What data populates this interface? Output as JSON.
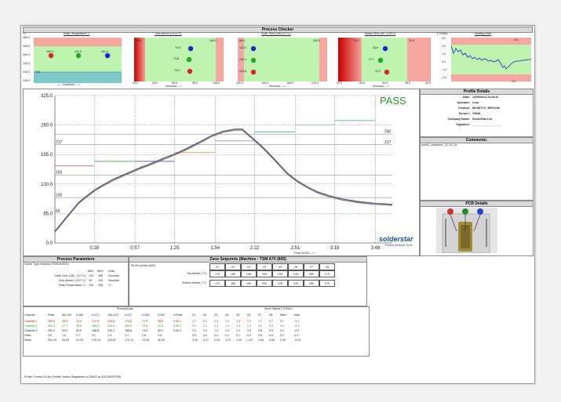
{
  "header": {
    "title": "Process Checker"
  },
  "mini_panels": [
    {
      "title": "Peak Temperature°C",
      "unit": "°C",
      "yticks": [
        "260.0",
        "255.0",
        "250.0",
        "245.0",
        "240.0",
        "235.0"
      ],
      "xlabel": "<--- Channels --->",
      "values": [
        "250.9",
        "251.3",
        "251.4"
      ],
      "marker": "240"
    },
    {
      "title": "Time Above (>217°C)",
      "left": "30.0",
      "right": "100.0",
      "xticks": [
        "25.0",
        "45.0",
        "65.0",
        "85.0",
        "105.0"
      ],
      "xlabel": "Seconds --->",
      "values": [
        "74.5",
        "73.8",
        "75.9"
      ]
    },
    {
      "title": "Soak Time (150-217°C)",
      "left": "60.0",
      "right": "240.0",
      "xticks": [
        "120.0",
        "150.0",
        "180.0",
        "210.0"
      ],
      "xlabel": "Seconds --->",
      "values": [
        "130.0",
        "130.4",
        "129.8"
      ],
      "left_labels": [
        "120.0",
        "130.4",
        "125.8"
      ]
    },
    {
      "title": "Ramp Time (65 - 125°C)",
      "left": "25.0",
      "right": "35.0",
      "xticks": [
        "20.0",
        "25.0",
        "30.0",
        "35.0",
        "40.0"
      ],
      "xlabel": "Seconds --->",
      "values": [
        "28.6",
        "27.7",
        "29.3"
      ],
      "left_labels": [
        "25.0",
        "27.7",
        "23.3"
      ]
    },
    {
      "title": "Heating Rate",
      "unit": "(°C/Sec)",
      "yticks": [
        "3.0",
        "2.0",
        "1.0",
        "0.0",
        "-1.0",
        "-2.0"
      ],
      "upper": "4.5",
      "lower": "-4.5"
    }
  ],
  "main_chart": {
    "status": "PASS",
    "yticks": [
      "325.0",
      "260.0",
      "195.0",
      "130.0",
      "65.0",
      "0.0"
    ],
    "xticks": [
      "0:28",
      "0:57",
      "1:25",
      "1:54",
      "2:22",
      "2:51",
      "3:19",
      "3:48"
    ],
    "xlabel": "Time M:SS --->",
    "lines": {
      "l217_left": "217",
      "l217_right": "217",
      "l240": "240",
      "l150": "150",
      "l100": "100",
      "l65": "65"
    },
    "logo": "solderstar",
    "logo_sub": "Reflow Analysis Tools"
  },
  "profile_details": {
    "title": "Profile Details",
    "rows": [
      {
        "label": "Date:",
        "value": "13/09/2014 10:29:20"
      },
      {
        "label": "Operator:",
        "value": "Luca"
      },
      {
        "label": "Product:",
        "value": "MUSETTO_REFLOW"
      },
      {
        "label": "Serial #:",
        "value": "10538"
      },
      {
        "label": "Company Name:",
        "value": "SolderStar Ltd"
      },
      {
        "label": "Signature:",
        "value": "___________________"
      }
    ]
  },
  "comments": {
    "title": "Comments:",
    "text": "profilo_campione_13_09_14"
  },
  "pcb_details": {
    "title": "PCB Details"
  },
  "process_parameters": {
    "title": "Process Parameters",
    "solder_type": "Solder Type:marasus F520SA30C5",
    "cols": [
      "MIN",
      "MAX",
      "Units"
    ],
    "rows": [
      {
        "label": "Soak Time (150 - 217°C)",
        "min": "120",
        "max": "260",
        "unit": "Seconds"
      },
      {
        "label": "Time Above (>217°C)",
        "min": "30",
        "max": "100",
        "unit": "Seconds"
      },
      {
        "label": "Peak Temperature °C",
        "min": "240",
        "max": "255",
        "unit": "°C"
      }
    ]
  },
  "zone_setpoints": {
    "title": "Zone Setpoints (Machine : TSM A70 (805)",
    "speed": "60.00 cm/min (A/R)",
    "zones": [
      "Z1",
      "Z2",
      "Z3",
      "Z4",
      "Z5",
      "Z6",
      "Z7",
      "Z8"
    ],
    "rows": [
      {
        "label": "Top Heater (°C)",
        "values": [
          "170",
          "180",
          "180",
          "200",
          "225",
          "245",
          "260",
          "270"
        ]
      },
      {
        "label": "Bottom Heater (°C)",
        "values": [
          "170",
          "180",
          "180",
          "200",
          "225",
          "245",
          "260",
          "270"
        ]
      }
    ]
  },
  "process_data": {
    "title": "ProcessData",
    "title2": "Zone Slopes (°C/Sec)",
    "headers": [
      "Channel",
      "Peak",
      "65<120",
      "t>150",
      "t>217",
      "150<217",
      "t>217",
      "t>230",
      "t>240",
      "t>Peak",
      "Z1",
      "Z2",
      "Z3",
      "Z4",
      "Z5",
      "Z6",
      "Z7",
      "Z8",
      "Max+",
      "Max-"
    ],
    "rows": [
      {
        "cls": "red",
        "cells": [
          "Channel 1",
          "250.9",
          "28.5",
          "33.4",
          "172.6",
          "129.8",
          "173.6",
          "71.9",
          "38.9",
          "0:40.1",
          "2.7",
          "2.1",
          "1.2",
          "1.2",
          "1.3",
          "1.3",
          "1.7",
          "0.7",
          "3.7",
          "-5.1"
        ]
      },
      {
        "cls": "grn",
        "cells": [
          "Channel 2",
          "251.3",
          "27.7",
          "28.8",
          "169.4",
          "130.4",
          "169.4",
          "73.8",
          "41.3",
          "0:40.1",
          "3.3",
          "2.1",
          "1.3",
          "1.3",
          "1.4",
          "1.2",
          "0.9",
          "0.8",
          "3.0",
          "-5.4"
        ]
      },
      {
        "cls": "blu",
        "cells": [
          "Channel 3",
          "251.4",
          "25.9",
          "30.9",
          "168.8",
          "130.1",
          "168.8",
          "74.5",
          "40.2",
          "0:40.1",
          "2.2",
          "2.1",
          "1.2",
          "1.2",
          "1.2",
          "1.9",
          "0.8",
          "0.2",
          "3.2",
          "-5.2"
        ]
      },
      {
        "cls": "",
        "cells": [
          "Delta",
          "0.5",
          "1.6",
          "2.7",
          "3.1",
          "1.9",
          "3.1",
          "2.6",
          "2.0",
          "",
          "0.5",
          "0.0",
          "0.1",
          "0.1",
          "0.1",
          "0.2",
          "0.5",
          "0.5",
          "0.2",
          "0.3"
        ]
      },
      {
        "cls": "",
        "cells": [
          "Mean",
          "251.20",
          "28.03",
          "31.03",
          "170.13",
          "129.57",
          "170.13",
          "73.40",
          "40.00",
          "",
          "3.40",
          "2.17",
          "1.23",
          "1.27",
          "1.30",
          "1.23",
          "1.60",
          "0.93",
          "3.40",
          "-5.23"
        ]
      }
    ]
  },
  "footer": {
    "text": "Profile Central V3.4m (Profile Seeker Registered to DEMO at SOLDERSTAR)"
  }
}
